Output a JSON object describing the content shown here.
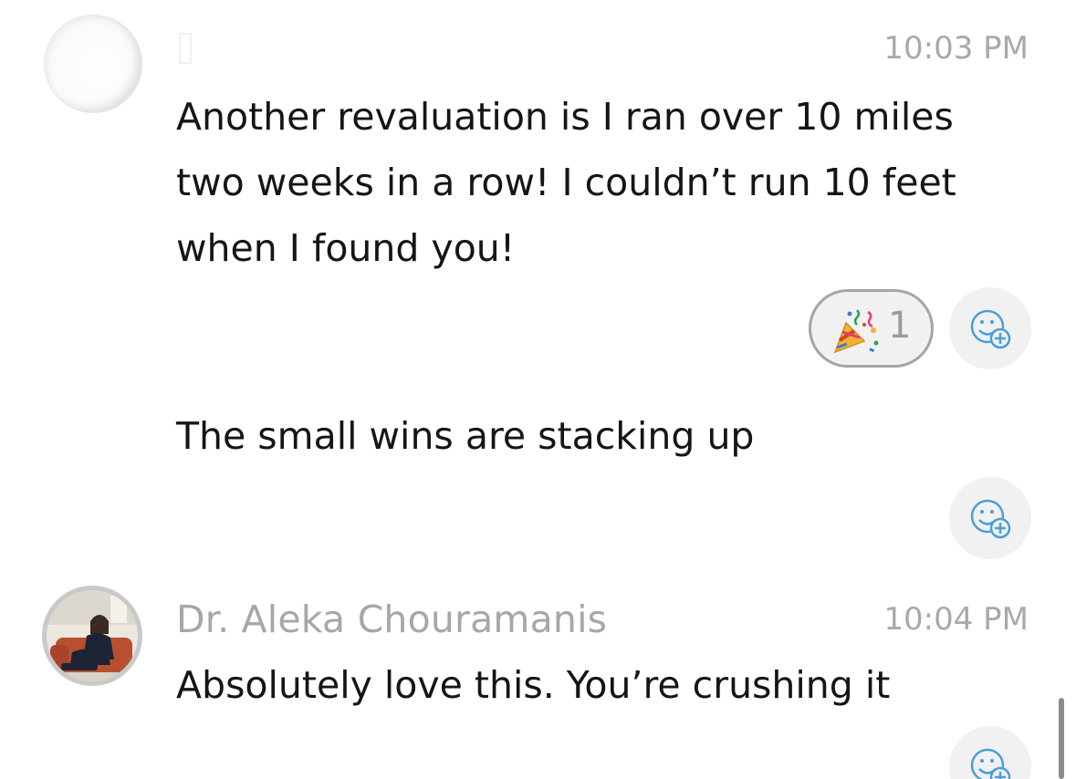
{
  "messages": [
    {
      "author": "",
      "time": "10:03 PM",
      "lines": [
        "Another revaluation is I ran over 10 miles",
        "two weeks in a row!  I couldn’t run 10 feet",
        "when I found you!"
      ],
      "reactions": [
        {
          "emoji": "party-popper-icon",
          "count": "1"
        }
      ]
    },
    {
      "text": "The small wins are stacking up",
      "reactions": []
    },
    {
      "author": "Dr. Aleka Chouramanis",
      "time": "10:04 PM",
      "text": "Absolutely love this. You’re crushing it",
      "reactions": []
    }
  ],
  "icons": {
    "add_reaction": "add-reaction-smiley-icon"
  },
  "colors": {
    "message_text": "#151515",
    "meta_text": "#a9a9a9",
    "reaction_bg": "#f1f1f1",
    "add_reaction_icon": "#4a9fd6"
  }
}
